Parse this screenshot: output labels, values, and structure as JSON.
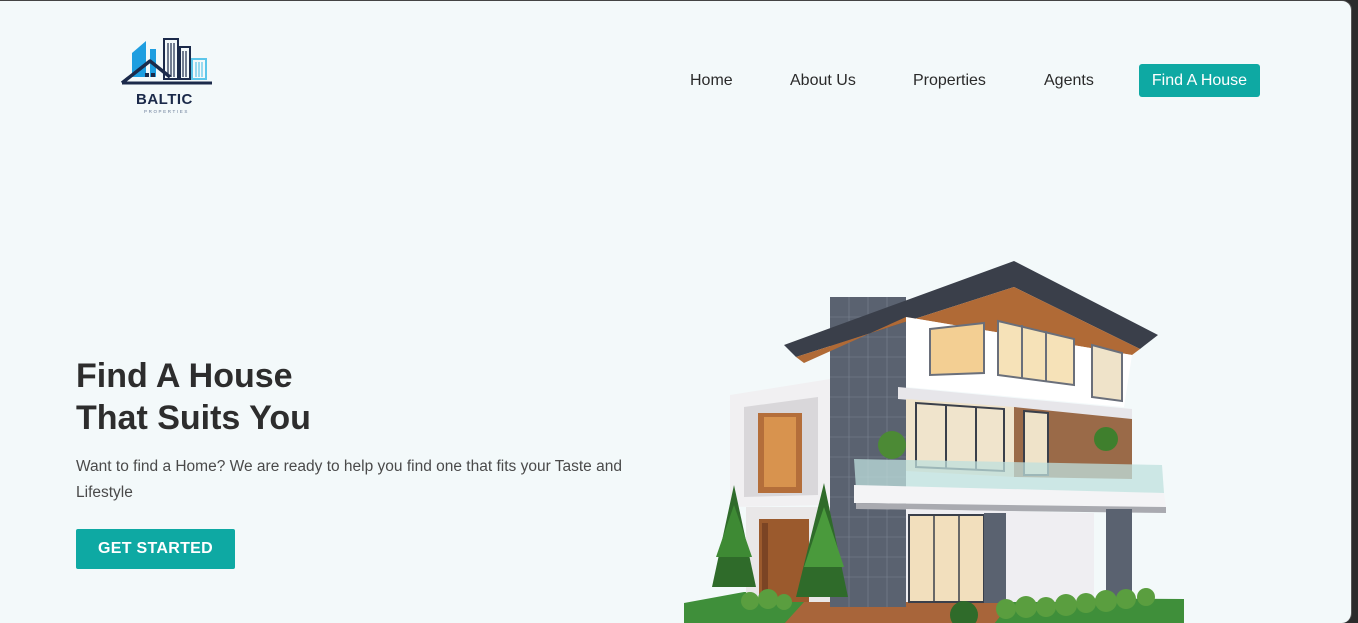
{
  "brand": {
    "name": "BALTIC",
    "tagline": "PROPERTIES",
    "logo_icon": "city-buildings-house-icon",
    "colors": {
      "navy": "#1b2a4a",
      "blue": "#1e9ee0",
      "light_blue": "#5cc6ea"
    }
  },
  "nav": {
    "items": [
      {
        "label": "Home"
      },
      {
        "label": "About Us"
      },
      {
        "label": "Properties"
      },
      {
        "label": "Agents"
      }
    ],
    "cta_label": "Find A House"
  },
  "hero": {
    "title_line1": "Find A House",
    "title_line2": "That Suits You",
    "description": "Want to find a Home? We are ready to help you find one that fits your Taste and Lifestyle",
    "button_label": "GET STARTED",
    "image": "modern-house-illustration"
  },
  "colors": {
    "accent": "#0ea9a3",
    "background": "#f3f9fa",
    "text": "#2d2d2d"
  }
}
